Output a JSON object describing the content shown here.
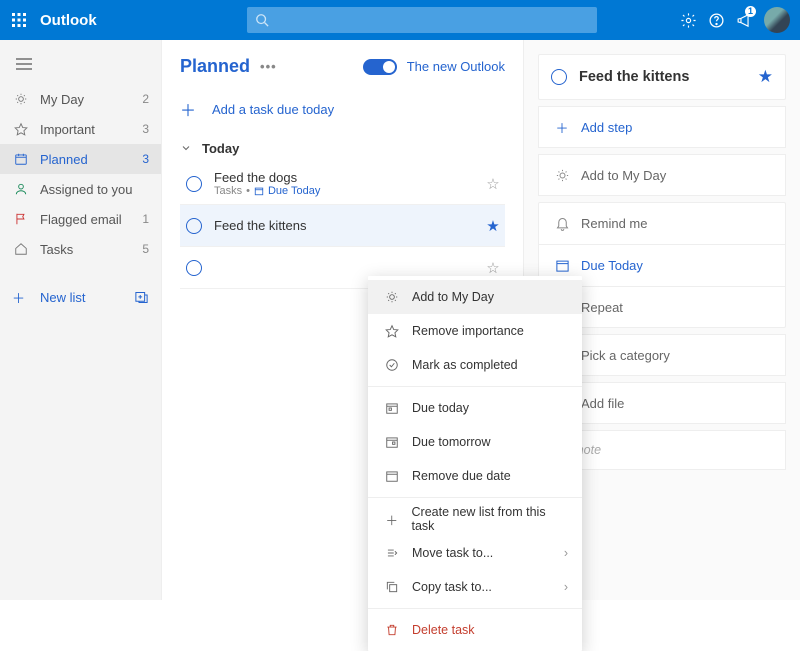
{
  "header": {
    "brand": "Outlook",
    "notification_count": "1"
  },
  "sidebar": {
    "items": [
      {
        "icon": "sun",
        "label": "My Day",
        "count": "2"
      },
      {
        "icon": "star",
        "label": "Important",
        "count": "3"
      },
      {
        "icon": "calendar",
        "label": "Planned",
        "count": "3",
        "active": true
      },
      {
        "icon": "person",
        "label": "Assigned to you",
        "count": ""
      },
      {
        "icon": "flag",
        "label": "Flagged email",
        "count": "1"
      },
      {
        "icon": "home",
        "label": "Tasks",
        "count": "5"
      }
    ],
    "new_list_label": "New list"
  },
  "center": {
    "title": "Planned",
    "toggle_label": "The new Outlook",
    "add_task_label": "Add a task due today",
    "group_label": "Today",
    "tasks": [
      {
        "title": "Feed the dogs",
        "meta_list": "Tasks",
        "meta_due": "Due Today",
        "starred": false
      },
      {
        "title": "Feed the kittens",
        "meta_list": "",
        "meta_due": "",
        "starred": true,
        "selected": true
      },
      {
        "title": "",
        "meta_list": "",
        "meta_due": "",
        "starred": false
      }
    ]
  },
  "context_menu": {
    "add_my_day": "Add to My Day",
    "remove_imp": "Remove importance",
    "mark_done": "Mark as completed",
    "due_today": "Due today",
    "due_tomorrow": "Due tomorrow",
    "remove_due": "Remove due date",
    "create_list": "Create new list from this task",
    "move_to": "Move task to...",
    "copy_to": "Copy task to...",
    "delete": "Delete task"
  },
  "detail": {
    "title": "Feed the kittens",
    "add_step": "Add step",
    "add_my_day": "Add to My Day",
    "remind": "Remind me",
    "due": "Due Today",
    "repeat": "Repeat",
    "category": "Pick a category",
    "add_file": "Add file",
    "note_placeholder": "Add note"
  }
}
